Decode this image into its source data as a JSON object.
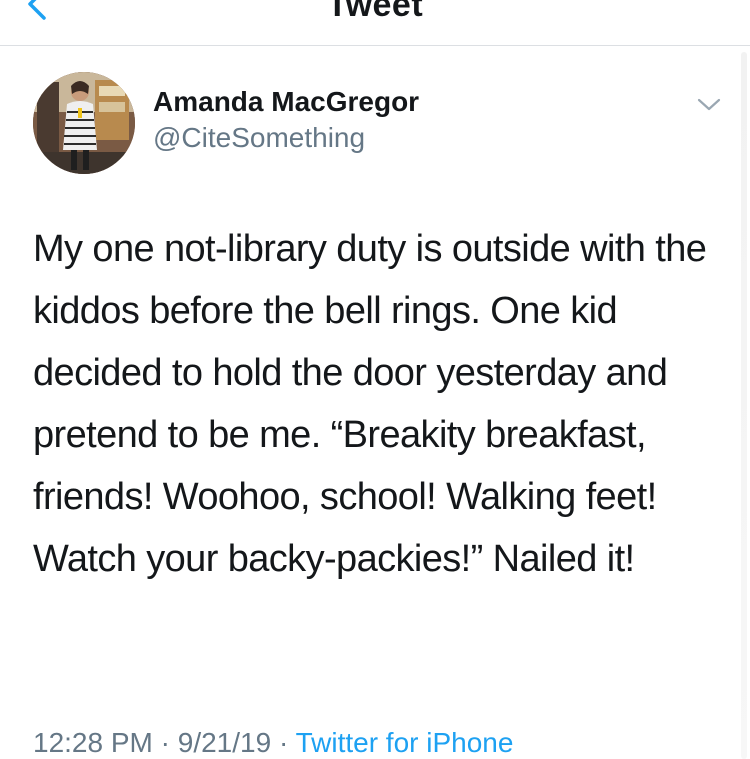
{
  "nav": {
    "title": "Tweet",
    "back_icon": "chevron-left-icon",
    "back_color": "#1da1f2"
  },
  "author": {
    "name": "Amanda MacGregor",
    "handle": "@CiteSomething",
    "avatar_icon": "avatar-photo",
    "menu_icon": "chevron-down-icon"
  },
  "tweet": {
    "text": "My one not-library duty is outside with the kiddos before the bell rings. One kid decided to hold the door yesterday and pretend to be me. “Breakity breakfast, friends! Woohoo, school! Walking feet! Watch your backy-packies!” Nailed it!"
  },
  "meta": {
    "time": "12:28 PM",
    "date": "9/21/19",
    "separator": "·",
    "source": "Twitter for iPhone"
  },
  "colors": {
    "accent": "#1da1f2",
    "text": "#14171a",
    "secondary": "#657786",
    "divider": "#dcdfe3"
  }
}
